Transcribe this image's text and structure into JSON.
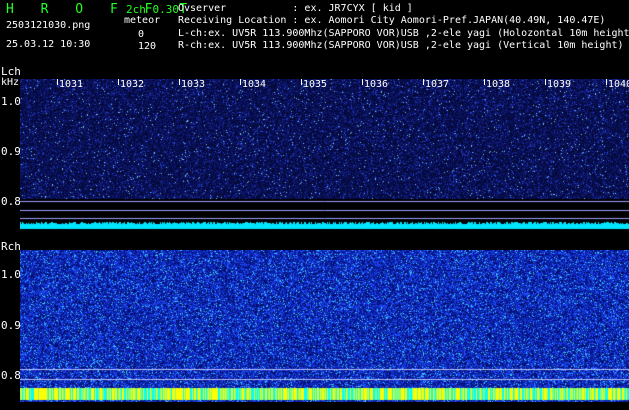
{
  "header": {
    "app_title": "H R O F F T",
    "mode": "2ch 0.30",
    "filename": "2503121030.png",
    "meteor_label": "meteor",
    "timestamp": "25.03.12 10:30",
    "lch_count": "0",
    "rch_count": "120"
  },
  "info": {
    "observer": "Ovserver           : ex. JR7CYX [ kid ]",
    "location": "Receiving Location : ex. Aomori City Aomori-Pref.JAPAN(40.49N, 140.47E)",
    "lch": "L-ch:ex. UV5R 113.900Mhz(SAPPORO VOR)USB ,2-ele yagi (Holozontal 10m height",
    "rch": "R-ch:ex. UV5R 113.900Mhz(SAPPORO VOR)USB ,2-ele yagi (Vertical 10m height)"
  },
  "lch_panel": {
    "label": "Lch",
    "unit": "kHz",
    "y_ticks": [
      "1.0",
      "0.9",
      "0.8"
    ],
    "x_ticks": [
      "1031",
      "1032",
      "1033",
      "1034",
      "1035",
      "1036",
      "1037",
      "1038",
      "1039",
      "1040"
    ]
  },
  "rch_panel": {
    "label": "Rch",
    "y_ticks": [
      "1.0",
      "0.9",
      "0.8"
    ]
  },
  "colors": {
    "background": "#000000",
    "noise_low": "#0a1a7a",
    "noise_high": "#2a4cff",
    "trace": "#00ffff",
    "signal": "#ffff00",
    "header_green": "#22ff22"
  }
}
